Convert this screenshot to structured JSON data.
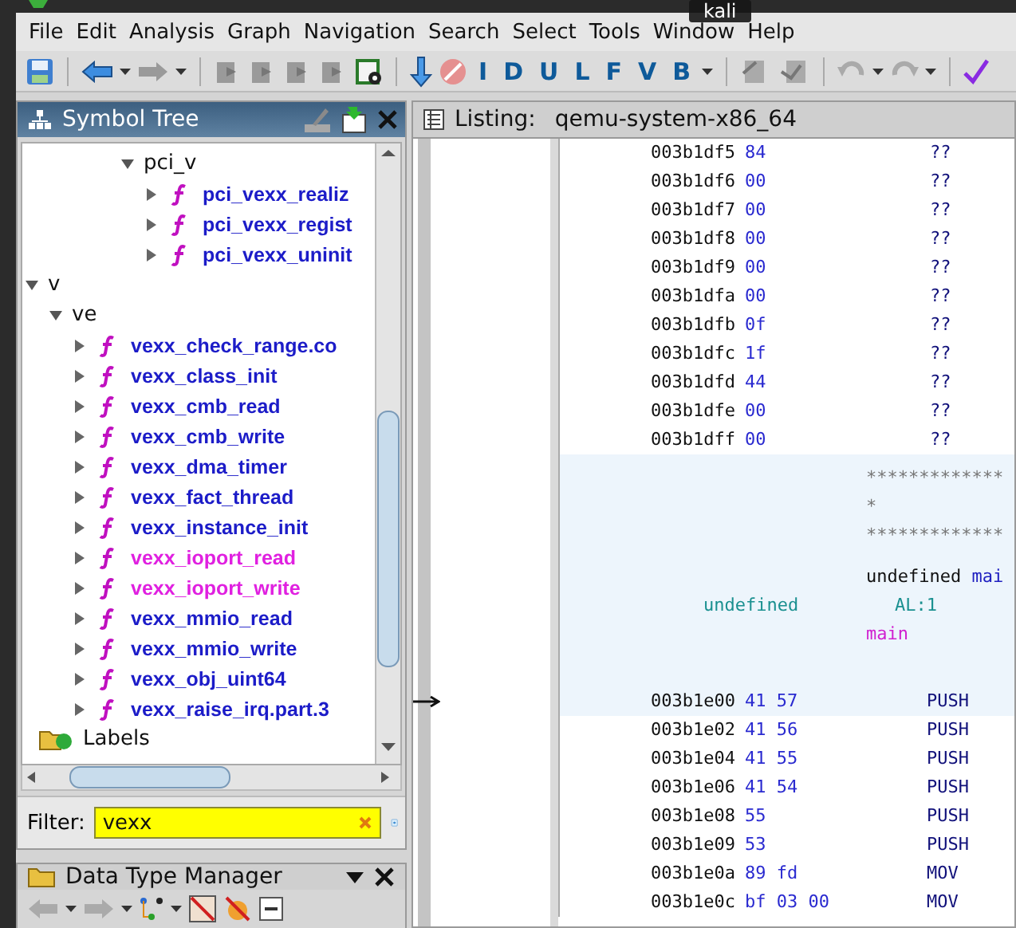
{
  "menu": [
    {
      "label": "File"
    },
    {
      "label": "Edit"
    },
    {
      "label": "Analysis"
    },
    {
      "label": "Graph"
    },
    {
      "label": "Navigation"
    },
    {
      "label": "Search"
    },
    {
      "label": "Select"
    },
    {
      "label": "Tools"
    },
    {
      "label": "Window"
    },
    {
      "label": "Help"
    }
  ],
  "tooltip": {
    "text": "kali"
  },
  "toolbar": {
    "letter_buttons": [
      {
        "label": "I"
      },
      {
        "label": "D"
      },
      {
        "label": "U"
      },
      {
        "label": "L"
      },
      {
        "label": "F"
      },
      {
        "label": "V"
      },
      {
        "label": "B"
      }
    ]
  },
  "symbol_tree": {
    "title": "Symbol Tree",
    "nodes": [
      {
        "children": [
          {
            "label": "pci_v",
            "kind": "folder",
            "expanded": true,
            "children": [
              {
                "label": "pci_vexx_realiz",
                "kind": "function",
                "expanded": false,
                "color": "#1c1cc8"
              },
              {
                "label": "pci_vexx_regist",
                "kind": "function",
                "expanded": false,
                "color": "#1c1cc8"
              },
              {
                "label": "pci_vexx_uninit",
                "kind": "function",
                "expanded": false,
                "color": "#1c1cc8"
              }
            ]
          }
        ]
      },
      {
        "label": "v",
        "kind": "folder",
        "expanded": true,
        "children": [
          {
            "label": "ve",
            "kind": "folder",
            "expanded": true,
            "children": [
              {
                "label": "vexx_check_range.co",
                "kind": "function",
                "expanded": false,
                "color": "#1c1cc8"
              },
              {
                "label": "vexx_class_init",
                "kind": "function",
                "expanded": false,
                "color": "#1c1cc8"
              },
              {
                "label": "vexx_cmb_read",
                "kind": "function",
                "expanded": false,
                "color": "#1c1cc8"
              },
              {
                "label": "vexx_cmb_write",
                "kind": "function",
                "expanded": false,
                "color": "#1c1cc8"
              },
              {
                "label": "vexx_dma_timer",
                "kind": "function",
                "expanded": false,
                "color": "#1c1cc8"
              },
              {
                "label": "vexx_fact_thread",
                "kind": "function",
                "expanded": false,
                "color": "#1c1cc8"
              },
              {
                "label": "vexx_instance_init",
                "kind": "function",
                "expanded": false,
                "color": "#1c1cc8"
              },
              {
                "label": "vexx_ioport_read",
                "kind": "function",
                "expanded": false,
                "color": "#e020e0"
              },
              {
                "label": "vexx_ioport_write",
                "kind": "function",
                "expanded": false,
                "color": "#e020e0"
              },
              {
                "label": "vexx_mmio_read",
                "kind": "function",
                "expanded": false,
                "color": "#1c1cc8"
              },
              {
                "label": "vexx_mmio_write",
                "kind": "function",
                "expanded": false,
                "color": "#1c1cc8"
              },
              {
                "label": "vexx_obj_uint64",
                "kind": "function",
                "expanded": false,
                "color": "#1c1cc8"
              },
              {
                "label": "vexx_raise_irq.part.3",
                "kind": "function",
                "expanded": false,
                "color": "#1c1cc8"
              }
            ]
          }
        ]
      },
      {
        "label": "Labels",
        "kind": "labels"
      }
    ],
    "filter": {
      "label": "Filter:",
      "value": "vexx"
    }
  },
  "listing": {
    "title": "Listing:",
    "program": "qemu-system-x86_64",
    "rows": [
      {
        "kind": "data",
        "address": "003b1df5",
        "bytes": "84",
        "value": "??",
        "current": false
      },
      {
        "kind": "data",
        "address": "003b1df6",
        "bytes": "00",
        "value": "??",
        "current": false
      },
      {
        "kind": "data",
        "address": "003b1df7",
        "bytes": "00",
        "value": "??",
        "current": false
      },
      {
        "kind": "data",
        "address": "003b1df8",
        "bytes": "00",
        "value": "??",
        "current": false
      },
      {
        "kind": "data",
        "address": "003b1df9",
        "bytes": "00",
        "value": "??",
        "current": false
      },
      {
        "kind": "data",
        "address": "003b1dfa",
        "bytes": "00",
        "value": "??",
        "current": false
      },
      {
        "kind": "data",
        "address": "003b1dfb",
        "bytes": "0f",
        "value": "??",
        "current": false
      },
      {
        "kind": "data",
        "address": "003b1dfc",
        "bytes": "1f",
        "value": "??",
        "current": false
      },
      {
        "kind": "data",
        "address": "003b1dfd",
        "bytes": "44",
        "value": "??",
        "current": false
      },
      {
        "kind": "data",
        "address": "003b1dfe",
        "bytes": "00",
        "value": "??",
        "current": false
      },
      {
        "kind": "data",
        "address": "003b1dff",
        "bytes": "00",
        "value": "??",
        "current": false
      },
      {
        "kind": "function_header",
        "comment_lines": [
          "*************",
          "*",
          "*************"
        ],
        "signature_type": "undefined",
        "signature_name": "mai",
        "return_type": "undefined",
        "return_storage": "AL:1",
        "label": "main"
      },
      {
        "kind": "instruction",
        "address": "003b1e00",
        "bytes": "41 57",
        "mnemonic": "PUSH",
        "current": true
      },
      {
        "kind": "instruction",
        "address": "003b1e02",
        "bytes": "41 56",
        "mnemonic": "PUSH",
        "current": false
      },
      {
        "kind": "instruction",
        "address": "003b1e04",
        "bytes": "41 55",
        "mnemonic": "PUSH",
        "current": false
      },
      {
        "kind": "instruction",
        "address": "003b1e06",
        "bytes": "41 54",
        "mnemonic": "PUSH",
        "current": false
      },
      {
        "kind": "instruction",
        "address": "003b1e08",
        "bytes": "55",
        "mnemonic": "PUSH",
        "current": false
      },
      {
        "kind": "instruction",
        "address": "003b1e09",
        "bytes": "53",
        "mnemonic": "PUSH",
        "current": false
      },
      {
        "kind": "instruction",
        "address": "003b1e0a",
        "bytes": "89 fd",
        "mnemonic": "MOV",
        "current": false
      },
      {
        "kind": "instruction",
        "address": "003b1e0c",
        "bytes": "bf 03 00",
        "mnemonic": "MOV",
        "current": false
      }
    ]
  },
  "data_type_manager": {
    "title": "Data Type Manager"
  }
}
